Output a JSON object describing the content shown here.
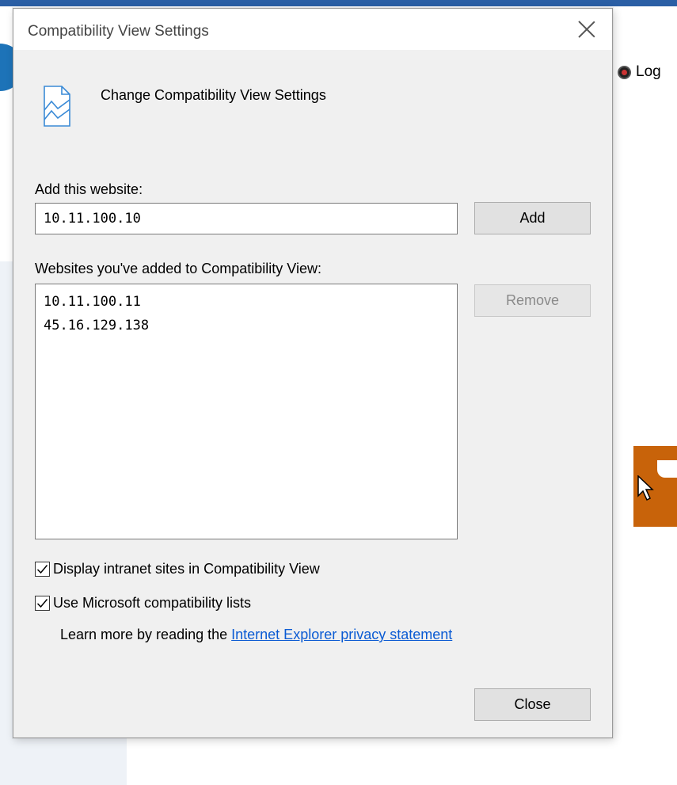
{
  "background": {
    "user_label": "Log"
  },
  "dialog": {
    "title": "Compatibility View Settings",
    "header_text": "Change Compatibility View Settings",
    "add_label": "Add this website:",
    "add_input_value": "10.11.100.10",
    "add_button": "Add",
    "list_label": "Websites you've added to Compatibility View:",
    "sites": [
      "10.11.100.11",
      "45.16.129.138"
    ],
    "remove_button": "Remove",
    "checkbox_intranet": "Display intranet sites in Compatibility View",
    "checkbox_intranet_checked": true,
    "checkbox_ms_lists": "Use Microsoft compatibility lists",
    "checkbox_ms_lists_checked": true,
    "learn_prefix": "Learn more by reading the ",
    "learn_link": "Internet Explorer privacy statement",
    "close_button": "Close"
  },
  "icons": {
    "header": "compatibility-page-icon",
    "close": "close-icon",
    "check": "check-icon"
  },
  "colors": {
    "link": "#0b5bd3",
    "dialog_bg": "#f0f0f0",
    "orange_tile": "#c8630a"
  }
}
